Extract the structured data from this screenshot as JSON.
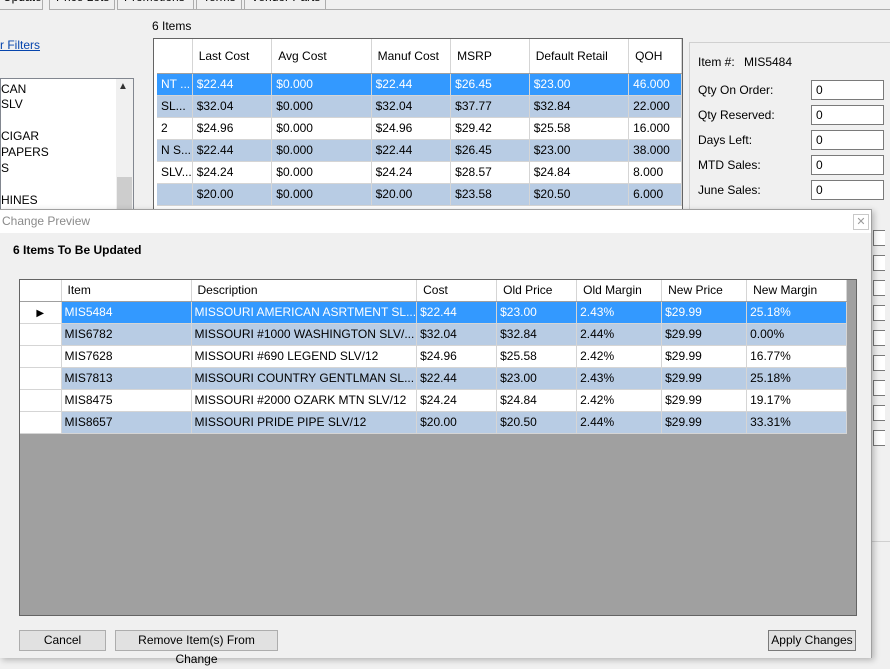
{
  "window": {
    "tabs": [
      "Updates",
      "Price Lots",
      "Promotions",
      "Terms",
      "Vendor Parts"
    ],
    "filters_link": "r Filters",
    "left_list": [
      "CAN",
      "SLV",
      "CIGAR",
      "PAPERS",
      "S",
      "HINES"
    ],
    "items_count": "6 Items",
    "grid": {
      "columns": [
        "",
        "Last Cost",
        "Avg Cost",
        "Manuf Cost",
        "MSRP",
        "Default Retail",
        "QOH"
      ],
      "rows": [
        [
          "NT ...",
          "$22.44",
          "$0.000",
          "$22.44",
          "$26.45",
          "$23.00",
          "46.000"
        ],
        [
          " SL...",
          "$32.04",
          "$0.000",
          "$32.04",
          "$37.77",
          "$32.84",
          "22.000"
        ],
        [
          "2",
          "$24.96",
          "$0.000",
          "$24.96",
          "$29.42",
          "$25.58",
          "16.000"
        ],
        [
          "N S...",
          "$22.44",
          "$0.000",
          "$22.44",
          "$26.45",
          "$23.00",
          "38.000"
        ],
        [
          "SLV...",
          "$24.24",
          "$0.000",
          "$24.24",
          "$28.57",
          "$24.84",
          "8.000"
        ],
        [
          "",
          "$20.00",
          "$0.000",
          "$20.00",
          "$23.58",
          "$20.50",
          "6.000"
        ]
      ]
    },
    "side": {
      "item_label": "Item #:",
      "item_value": "MIS5484",
      "fields": [
        {
          "label": "Qty On Order:",
          "value": "0"
        },
        {
          "label": "Qty Reserved:",
          "value": "0"
        },
        {
          "label": "Days Left:",
          "value": "0"
        },
        {
          "label": "MTD Sales:",
          "value": "0"
        },
        {
          "label": "June Sales:",
          "value": "0"
        }
      ]
    }
  },
  "dialog": {
    "title": "Change Preview",
    "heading": "6 Items To Be Updated",
    "columns": [
      "Item",
      "Description",
      "Cost",
      "Old Price",
      "Old Margin",
      "New Price",
      "New Margin"
    ],
    "rows": [
      [
        "MIS5484",
        "MISSOURI AMERICAN ASRTMENT SL...",
        "$22.44",
        "$23.00",
        "2.43%",
        "$29.99",
        "25.18%"
      ],
      [
        "MIS6782",
        "MISSOURI #1000 WASHINGTON SLV/...",
        "$32.04",
        "$32.84",
        "2.44%",
        "$29.99",
        "0.00%"
      ],
      [
        "MIS7628",
        "MISSOURI #690 LEGEND SLV/12",
        "$24.96",
        "$25.58",
        "2.42%",
        "$29.99",
        "16.77%"
      ],
      [
        "MIS7813",
        "MISSOURI COUNTRY GENTLMAN SL...",
        "$22.44",
        "$23.00",
        "2.43%",
        "$29.99",
        "25.18%"
      ],
      [
        "MIS8475",
        "MISSOURI  #2000 OZARK MTN SLV/12",
        "$24.24",
        "$24.84",
        "2.42%",
        "$29.99",
        "19.17%"
      ],
      [
        "MIS8657",
        "MISSOURI PRIDE PIPE SLV/12",
        "$20.00",
        "$20.50",
        "2.44%",
        "$29.99",
        "33.31%"
      ]
    ],
    "buttons": {
      "cancel": "Cancel",
      "remove": "Remove Item(s) From Change",
      "apply": "Apply Changes"
    }
  }
}
